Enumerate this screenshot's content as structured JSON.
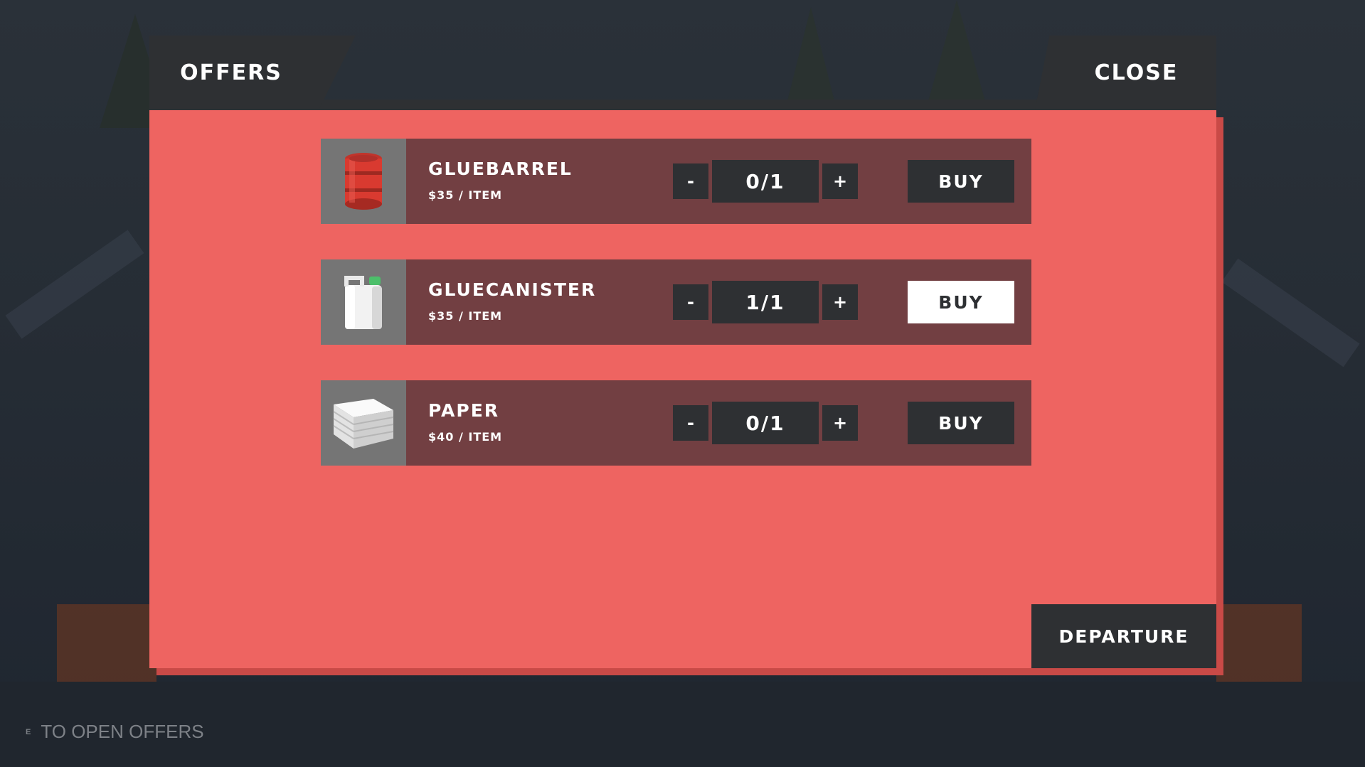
{
  "tabs": {
    "offers_label": "OFFERS",
    "close_label": "CLOSE"
  },
  "offers": [
    {
      "name": "GLUEBARREL",
      "price": "$35 / ITEM",
      "minus": "-",
      "qty": "0/1",
      "plus": "+",
      "buy": "BUY",
      "buy_active": false,
      "icon": "barrel-icon"
    },
    {
      "name": "GLUECANISTER",
      "price": "$35 / ITEM",
      "minus": "-",
      "qty": "1/1",
      "plus": "+",
      "buy": "BUY",
      "buy_active": true,
      "icon": "canister-icon"
    },
    {
      "name": "PAPER",
      "price": "$40 / ITEM",
      "minus": "-",
      "qty": "0/1",
      "plus": "+",
      "buy": "BUY",
      "buy_active": false,
      "icon": "paper-stack-icon"
    }
  ],
  "departure_label": "DEPARTURE",
  "hint": {
    "key": "E",
    "text": "TO OPEN OFFERS"
  },
  "colors": {
    "panel": "#ee6461",
    "row": "#723f42",
    "dark": "#2e3033",
    "thumb": "#757575",
    "active_buy": "#ffffff"
  }
}
